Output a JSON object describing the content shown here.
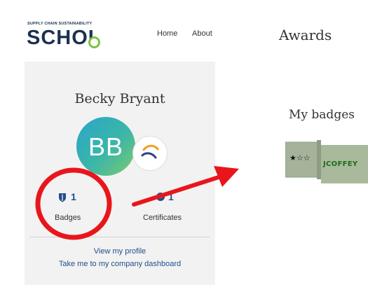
{
  "header": {
    "logo_tagline": "SUPPLY CHAIN SUSTAINABILITY",
    "logo_word": "SCHOL",
    "nav": [
      "Home",
      "About"
    ]
  },
  "profile": {
    "name": "Becky Bryant",
    "initials": "BB",
    "badges_count": "1",
    "badges_label": "Badges",
    "certificates_count": "1",
    "certificates_label": "Certificates",
    "view_profile_link": "View my profile",
    "dashboard_link": "Take me to my company dashboard"
  },
  "awards": {
    "title": "Awards",
    "my_badges_title": "My badges",
    "badge": {
      "rating_stars": "★☆☆",
      "label": "JCOFFEY"
    }
  },
  "colors": {
    "brand_navy": "#1b3150",
    "link_blue": "#1f4e8c",
    "panel_bg": "#f2f2f2",
    "badge_green": "#a8b89a",
    "annotation_red": "#e8161c"
  },
  "icons": {
    "badges": "shield-icon",
    "certificates": "certificate-seal-icon",
    "avatar_badge": "company-logo-icon"
  }
}
